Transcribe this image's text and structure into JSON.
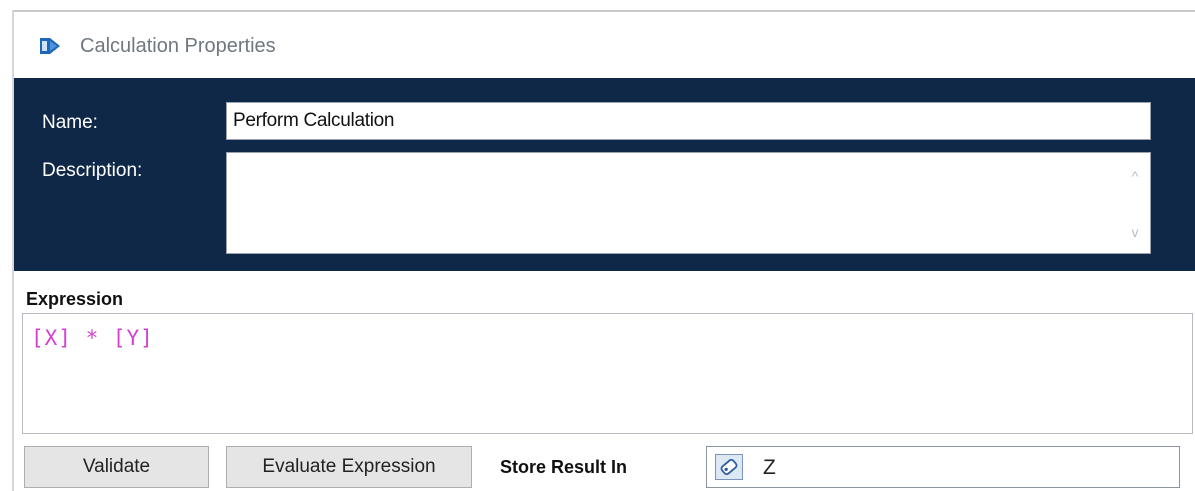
{
  "window": {
    "title": "Calculation Properties",
    "icon": "calculation-shape-icon"
  },
  "header": {
    "name_label": "Name:",
    "name_value": "Perform Calculation",
    "description_label": "Description:",
    "description_value": "",
    "scroll_up_glyph": "^",
    "scroll_down_glyph": "v"
  },
  "expression": {
    "label": "Expression",
    "value": "[X] * [Y]"
  },
  "buttons": {
    "validate": "Validate",
    "evaluate": "Evaluate Expression"
  },
  "store": {
    "label": "Store Result In",
    "value": "Z",
    "icon": "variable-tag-icon"
  },
  "colors": {
    "header_bg": "#0f2847",
    "expression_text": "#d63fd0"
  }
}
